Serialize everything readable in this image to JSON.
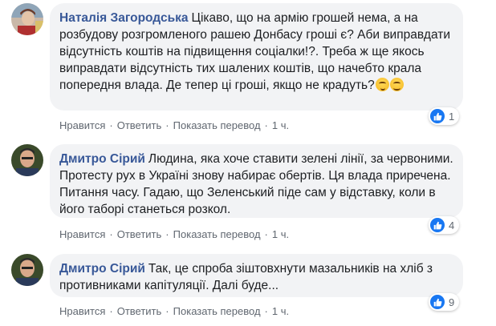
{
  "comments": [
    {
      "author": "Наталія Загородська",
      "text": "Цікаво, що на армію грошей нема, а на розбудову розгромленого рашею Донбасу гроші є? Аби виправдати відсутність коштів на підвищення соціалки!?. Треба ж ще якось виправдати відсутність тих шалених коштів, що начебто крала попередня влада. Де тепер ці гроші, якщо не крадуть?",
      "emoji": [
        "thinking-face-emoji",
        "smiling-face-emoji"
      ],
      "likes": "1",
      "like": "Нравится",
      "reply": "Ответить",
      "translate": "Показать перевод",
      "time": "1 ч."
    },
    {
      "author": "Дмитро Сірий",
      "text": "Людина, яка хоче ставити зелені лінії, за червоними. Протесту рух в Україні знову набирає обертів. Ця влада приречена. Питання часу. Гадаю, що Зеленський піде сам у відставку, коли в його таборі станеться розкол.",
      "likes": "4",
      "like": "Нравится",
      "reply": "Ответить",
      "translate": "Показать перевод",
      "time": "1 ч."
    },
    {
      "author": "Дмитро Сірий",
      "text": "Так, це спроба зіштовхнути мазальників на хліб з противниками капітуляції. Далі буде...",
      "likes": "9",
      "like": "Нравится",
      "reply": "Ответить",
      "translate": "Показать перевод",
      "time": "1 ч."
    }
  ],
  "colors": {
    "bubble": "#f2f3f5",
    "author": "#385898",
    "meta": "#606770",
    "like": "#1877f2"
  }
}
